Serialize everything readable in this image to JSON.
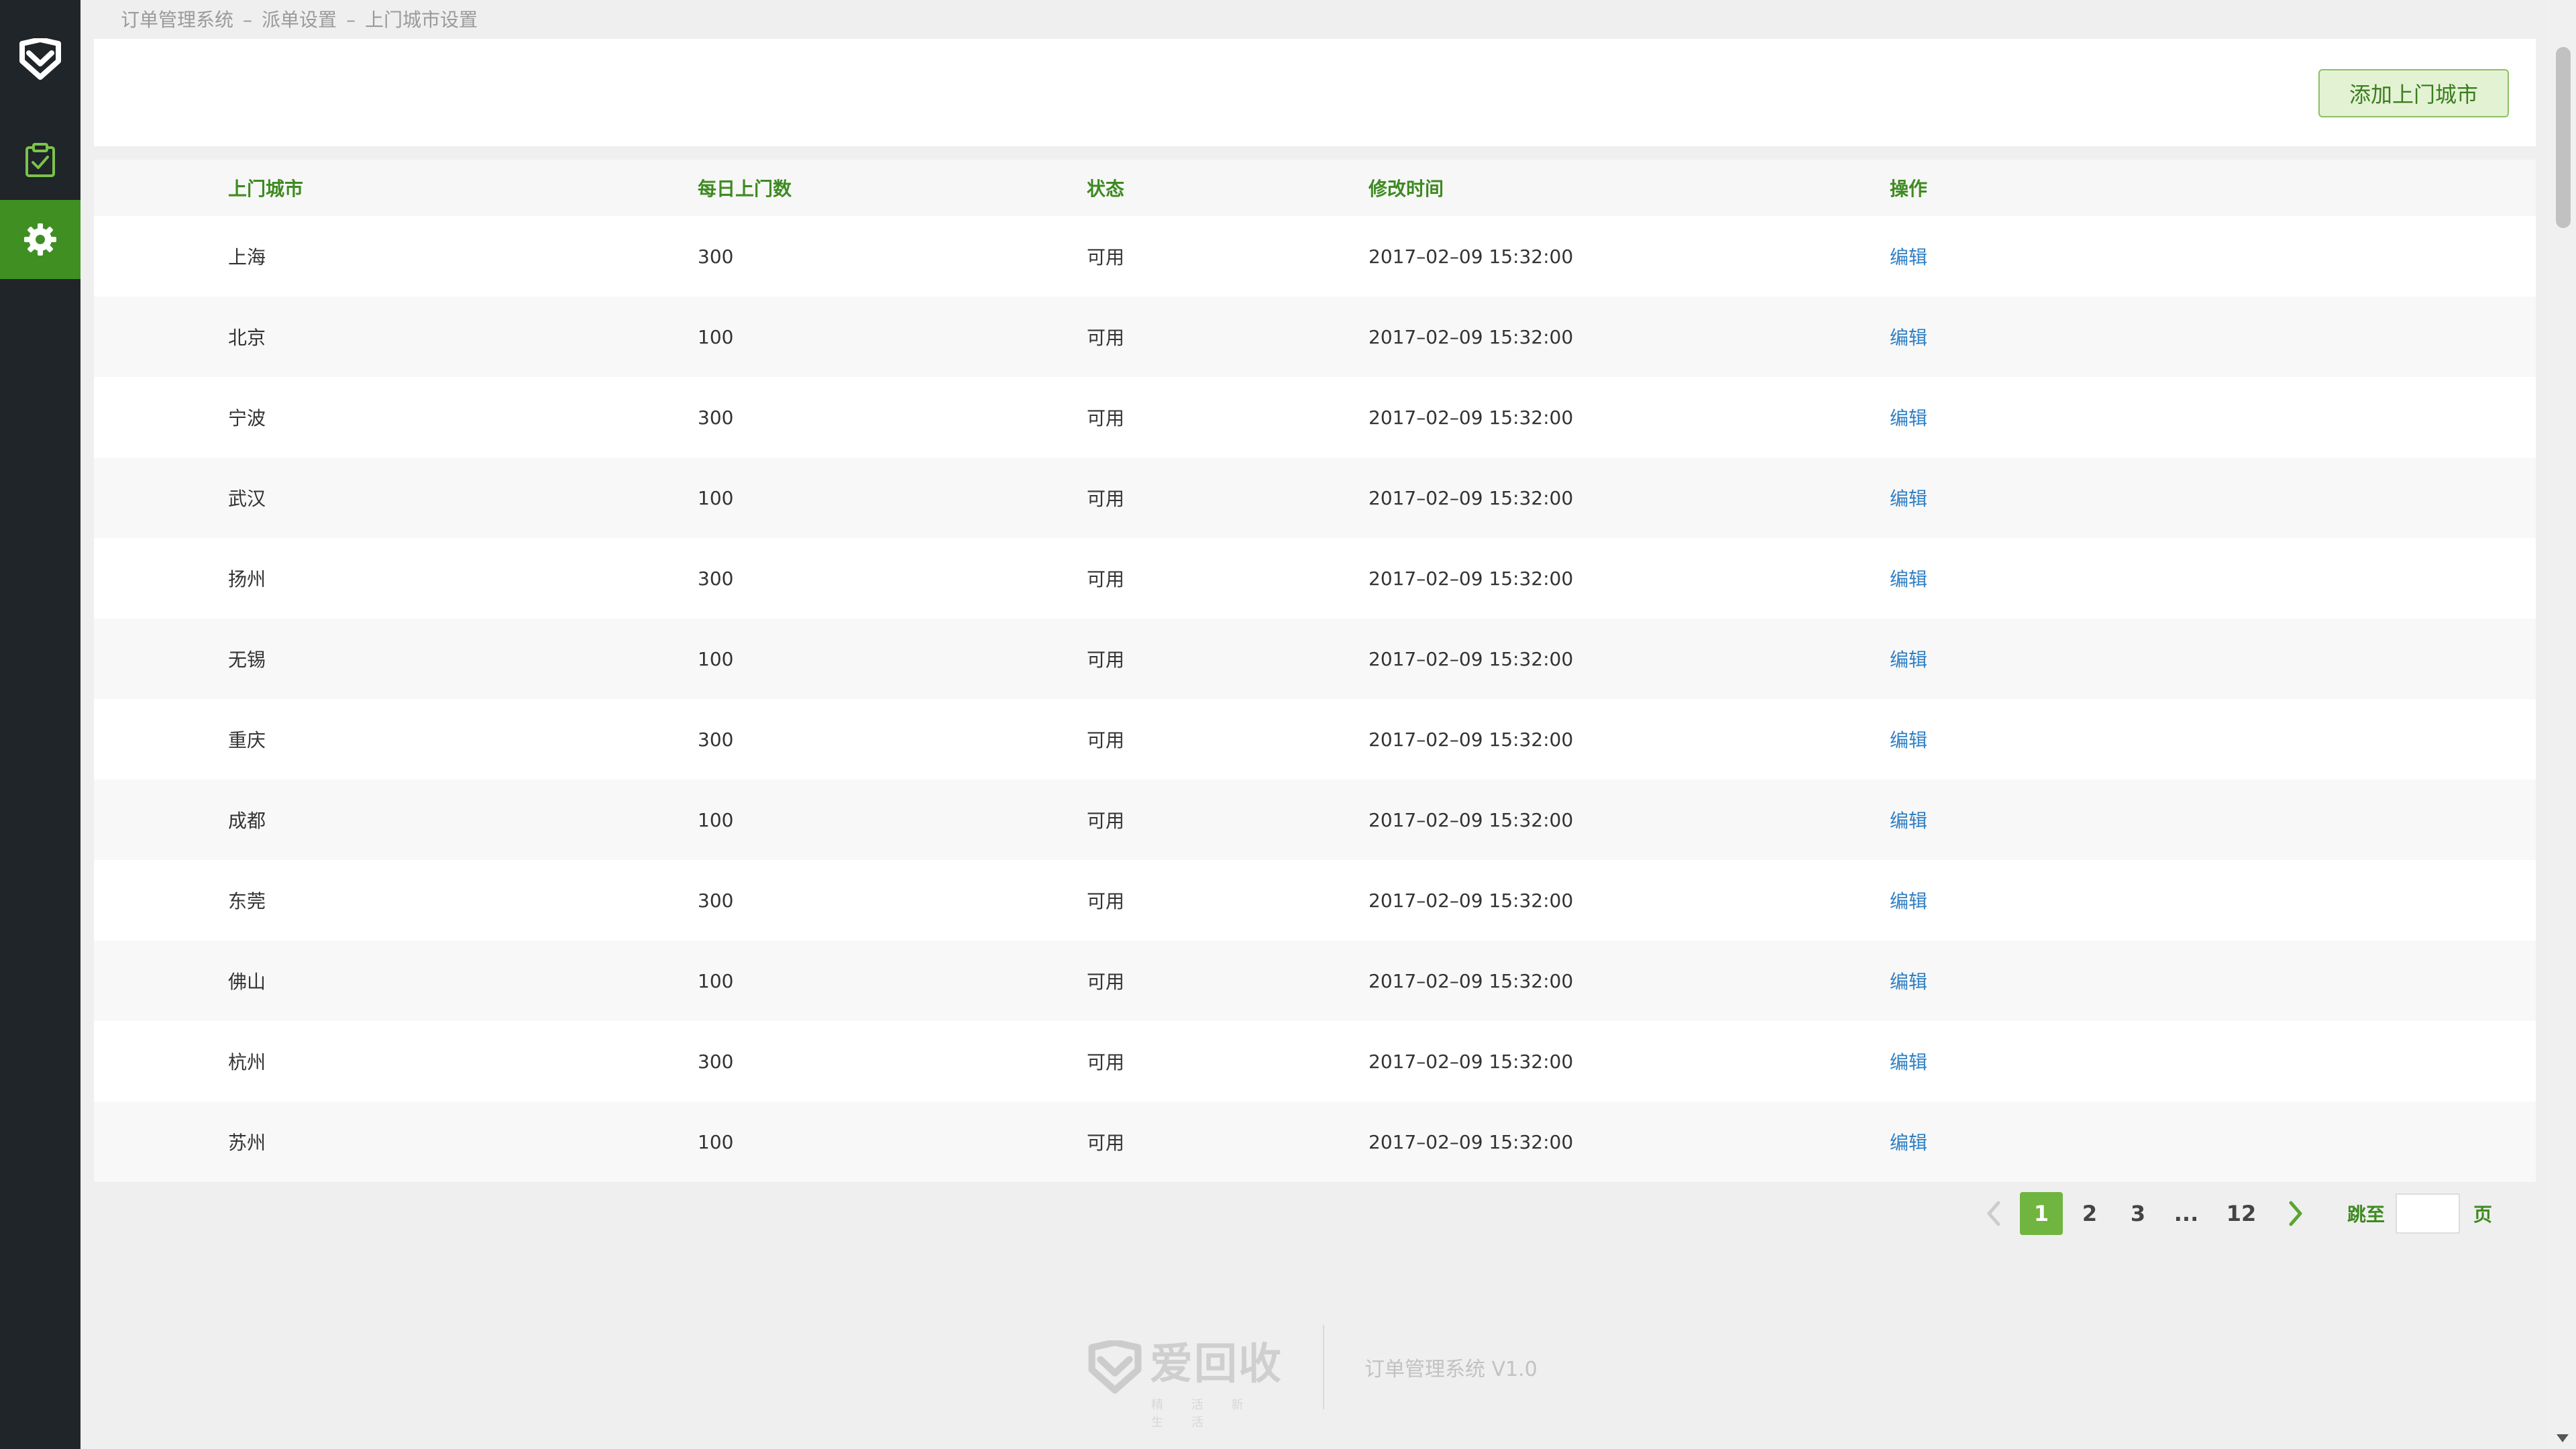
{
  "breadcrumb": {
    "items": [
      "订单管理系统",
      "派单设置",
      "上门城市设置"
    ],
    "separator": "–"
  },
  "toolbar": {
    "add_label": "添加上门城市"
  },
  "table": {
    "headers": [
      "上门城市",
      "每日上门数",
      "状态",
      "修改时间",
      "操作"
    ],
    "rows": [
      {
        "city": "上海",
        "daily": "300",
        "status": "可用",
        "time": "2017–02–09 15:32:00",
        "action": "编辑"
      },
      {
        "city": "北京",
        "daily": "100",
        "status": "可用",
        "time": "2017–02–09 15:32:00",
        "action": "编辑"
      },
      {
        "city": "宁波",
        "daily": "300",
        "status": "可用",
        "time": "2017–02–09 15:32:00",
        "action": "编辑"
      },
      {
        "city": "武汉",
        "daily": "100",
        "status": "可用",
        "time": "2017–02–09 15:32:00",
        "action": "编辑"
      },
      {
        "city": "扬州",
        "daily": "300",
        "status": "可用",
        "time": "2017–02–09 15:32:00",
        "action": "编辑"
      },
      {
        "city": "无锡",
        "daily": "100",
        "status": "可用",
        "time": "2017–02–09 15:32:00",
        "action": "编辑"
      },
      {
        "city": "重庆",
        "daily": "300",
        "status": "可用",
        "time": "2017–02–09 15:32:00",
        "action": "编辑"
      },
      {
        "city": "成都",
        "daily": "100",
        "status": "可用",
        "time": "2017–02–09 15:32:00",
        "action": "编辑"
      },
      {
        "city": "东莞",
        "daily": "300",
        "status": "可用",
        "time": "2017–02–09 15:32:00",
        "action": "编辑"
      },
      {
        "city": "佛山",
        "daily": "100",
        "status": "可用",
        "time": "2017–02–09 15:32:00",
        "action": "编辑"
      },
      {
        "city": "杭州",
        "daily": "300",
        "status": "可用",
        "time": "2017–02–09 15:32:00",
        "action": "编辑"
      },
      {
        "city": "苏州",
        "daily": "100",
        "status": "可用",
        "time": "2017–02–09 15:32:00",
        "action": "编辑"
      }
    ]
  },
  "pagination": {
    "pages": [
      "1",
      "2",
      "3"
    ],
    "ellipsis": "...",
    "last_page": "12",
    "current": "1",
    "jump_label": "跳至",
    "jump_value": "",
    "page_suffix": "页"
  },
  "footer": {
    "brand": "爱回收",
    "brand_sub": "精 活 新 生 活",
    "version": "订单管理系统 V1.0"
  },
  "icons": {
    "logo": "heart-shield-icon",
    "orders": "clipboard-check-icon",
    "settings": "gear-icon",
    "prev": "chevron-left-icon",
    "next": "chevron-right-icon"
  },
  "colors": {
    "sidebar_bg": "#1f2529",
    "accent_green": "#3f8f22",
    "active_page": "#6fb53f",
    "link_blue": "#2f7fc4",
    "header_text": "#3e8a21"
  }
}
